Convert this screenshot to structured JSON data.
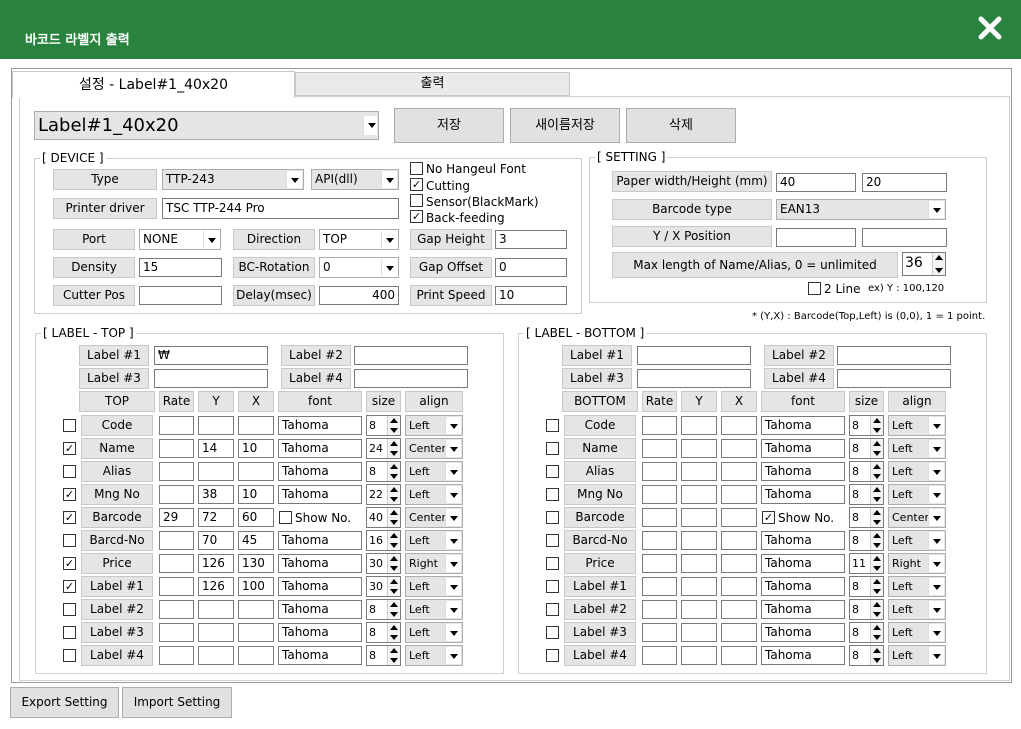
{
  "window": {
    "title": "바코드 라벨지 출력"
  },
  "tabs": [
    "설정 - Label#1_40x20",
    "출력"
  ],
  "top": {
    "profile": "Label#1_40x20",
    "save": "저장",
    "save_as": "새이름저장",
    "delete": "삭제"
  },
  "device": {
    "title": "[ DEVICE ]",
    "type_label": "Type",
    "type_value": "TTP-243",
    "api_value": "API(dll)",
    "driver_label": "Printer driver",
    "driver_value": "TSC TTP-244 Pro",
    "port_label": "Port",
    "port_value": "NONE",
    "direction_label": "Direction",
    "direction_value": "TOP",
    "density_label": "Density",
    "density_value": "15",
    "bcrot_label": "BC-Rotation",
    "bcrot_value": "0",
    "cutter_label": "Cutter Pos",
    "cutter_value": "",
    "delay_label": "Delay(msec)",
    "delay_value": "400",
    "gap_height_label": "Gap Height",
    "gap_height_value": "3",
    "gap_offset_label": "Gap Offset",
    "gap_offset_value": "0",
    "speed_label": "Print Speed",
    "speed_value": "10",
    "no_hangeul": "No Hangeul Font",
    "cutting": "Cutting",
    "sensor": "Sensor(BlackMark)",
    "backfeed": "Back-feeding",
    "checks": {
      "no_hangeul": "",
      "cutting": "✓",
      "sensor": "",
      "backfeed": "✓"
    }
  },
  "setting": {
    "title": "[ SETTING ]",
    "paper_label": "Paper width/Height (mm)",
    "paper_w": "40",
    "paper_h": "20",
    "bctype_label": "Barcode type",
    "bctype_value": "EAN13",
    "pos_label": "Y / X Position",
    "pos_y": "",
    "pos_x": "",
    "maxlen_label": "Max length of Name/Alias, 0 = unlimited",
    "maxlen_value": "36",
    "twoline": "2 Line",
    "twoline_ex": "ex) Y : 100,120",
    "note": "* (Y,X) : Barcode(Top,Left) is (0,0),   1 = 1 point."
  },
  "label_top": {
    "title": "[ LABEL - TOP ]",
    "labels": [
      {
        "name": "Label #1",
        "value": "₩"
      },
      {
        "name": "Label #2",
        "value": ""
      },
      {
        "name": "Label #3",
        "value": ""
      },
      {
        "name": "Label #4",
        "value": ""
      }
    ],
    "headers": [
      "TOP",
      "Rate",
      "Y",
      "X",
      "font",
      "size",
      "align"
    ],
    "rows": [
      {
        "checked": "",
        "field": "Code",
        "rate": "",
        "y": "",
        "x": "",
        "font": "Tahoma",
        "size": "8",
        "align": "Left"
      },
      {
        "checked": "✓",
        "field": "Name",
        "rate": "",
        "y": "14",
        "x": "10",
        "font": "Tahoma",
        "size": "24",
        "align": "Center"
      },
      {
        "checked": "",
        "field": "Alias",
        "rate": "",
        "y": "",
        "x": "",
        "font": "Tahoma",
        "size": "8",
        "align": "Left"
      },
      {
        "checked": "✓",
        "field": "Mng No",
        "rate": "",
        "y": "38",
        "x": "10",
        "font": "Tahoma",
        "size": "22",
        "align": "Left"
      },
      {
        "checked": "✓",
        "field": "Barcode",
        "rate": "29",
        "y": "72",
        "x": "60",
        "font": "Show No.",
        "font_check": "",
        "size": "40",
        "align": "Center"
      },
      {
        "checked": "",
        "field": "Barcd-No",
        "rate": "",
        "y": "70",
        "x": "45",
        "font": "Tahoma",
        "size": "16",
        "align": "Left"
      },
      {
        "checked": "✓",
        "field": "Price",
        "rate": "",
        "y": "126",
        "x": "130",
        "font": "Tahoma",
        "size": "30",
        "align": "Right"
      },
      {
        "checked": "✓",
        "field": "Label #1",
        "rate": "",
        "y": "126",
        "x": "100",
        "font": "Tahoma",
        "size": "30",
        "align": "Left"
      },
      {
        "checked": "",
        "field": "Label #2",
        "rate": "",
        "y": "",
        "x": "",
        "font": "Tahoma",
        "size": "8",
        "align": "Left"
      },
      {
        "checked": "",
        "field": "Label #3",
        "rate": "",
        "y": "",
        "x": "",
        "font": "Tahoma",
        "size": "8",
        "align": "Left"
      },
      {
        "checked": "",
        "field": "Label #4",
        "rate": "",
        "y": "",
        "x": "",
        "font": "Tahoma",
        "size": "8",
        "align": "Left"
      }
    ]
  },
  "label_bottom": {
    "title": "[ LABEL - BOTTOM ]",
    "labels": [
      {
        "name": "Label #1",
        "value": ""
      },
      {
        "name": "Label #2",
        "value": ""
      },
      {
        "name": "Label #3",
        "value": ""
      },
      {
        "name": "Label #4",
        "value": ""
      }
    ],
    "headers": [
      "BOTTOM",
      "Rate",
      "Y",
      "X",
      "font",
      "size",
      "align"
    ],
    "rows": [
      {
        "checked": "",
        "field": "Code",
        "rate": "",
        "y": "",
        "x": "",
        "font": "Tahoma",
        "size": "8",
        "align": "Left"
      },
      {
        "checked": "",
        "field": "Name",
        "rate": "",
        "y": "",
        "x": "",
        "font": "Tahoma",
        "size": "8",
        "align": "Left"
      },
      {
        "checked": "",
        "field": "Alias",
        "rate": "",
        "y": "",
        "x": "",
        "font": "Tahoma",
        "size": "8",
        "align": "Left"
      },
      {
        "checked": "",
        "field": "Mng No",
        "rate": "",
        "y": "",
        "x": "",
        "font": "Tahoma",
        "size": "8",
        "align": "Left"
      },
      {
        "checked": "",
        "field": "Barcode",
        "rate": "",
        "y": "",
        "x": "",
        "font": "Show No.",
        "font_check": "✓",
        "size": "8",
        "align": "Center"
      },
      {
        "checked": "",
        "field": "Barcd-No",
        "rate": "",
        "y": "",
        "x": "",
        "font": "Tahoma",
        "size": "8",
        "align": "Left"
      },
      {
        "checked": "",
        "field": "Price",
        "rate": "",
        "y": "",
        "x": "",
        "font": "Tahoma",
        "size": "11",
        "align": "Right"
      },
      {
        "checked": "",
        "field": "Label #1",
        "rate": "",
        "y": "",
        "x": "",
        "font": "Tahoma",
        "size": "8",
        "align": "Left"
      },
      {
        "checked": "",
        "field": "Label #2",
        "rate": "",
        "y": "",
        "x": "",
        "font": "Tahoma",
        "size": "8",
        "align": "Left"
      },
      {
        "checked": "",
        "field": "Label #3",
        "rate": "",
        "y": "",
        "x": "",
        "font": "Tahoma",
        "size": "8",
        "align": "Left"
      },
      {
        "checked": "",
        "field": "Label #4",
        "rate": "",
        "y": "",
        "x": "",
        "font": "Tahoma",
        "size": "8",
        "align": "Left"
      }
    ]
  },
  "footer": {
    "export": "Export Setting",
    "import": "Import Setting"
  },
  "colors": {
    "header": "#2a823f"
  }
}
